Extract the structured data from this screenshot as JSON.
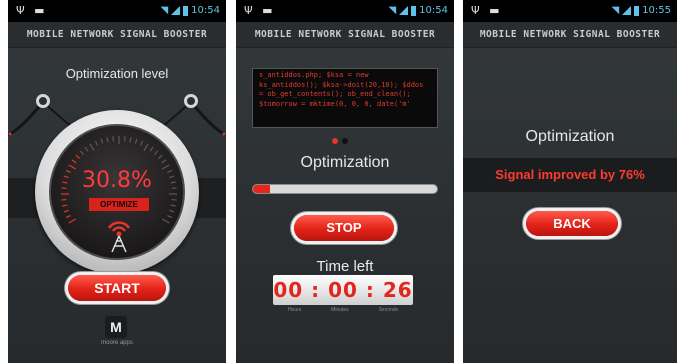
{
  "status_bar": {
    "screen1_time": "10:54",
    "screen2_time": "10:54",
    "screen3_time": "10:55",
    "accent": "#5ec3e8"
  },
  "app_title": "MOBILE NETWORK SIGNAL BOOSTER",
  "screen1": {
    "heading": "Optimization level",
    "percent": "30.8%",
    "percent_value": 30.8,
    "gauge_label": "OPTIMIZE",
    "start_label": "START",
    "logo_letter": "M",
    "logo_caption": "moore apps"
  },
  "screen2": {
    "log_lines": [
      "s_antiddos.php; $ksa = new",
      "ks_antiddos(); $ksa->doit(20,10); $ddos",
      "= ob_get_contents(); ob_end_clean();",
      "$tomorrow = mktime(0, 0, 0, date('m'"
    ],
    "heading": "Optimization",
    "progress": 0.09,
    "stop_label": "STOP",
    "time_left_label": "Time left",
    "timer": "00 : 00 : 26",
    "timer_units": [
      "Hours",
      "Minutes",
      "Seconds"
    ]
  },
  "screen3": {
    "heading": "Optimization",
    "result": "Signal improved by 76%",
    "back_label": "BACK"
  },
  "colors": {
    "accent_red": "#e5261c",
    "background": "#2d3133"
  }
}
